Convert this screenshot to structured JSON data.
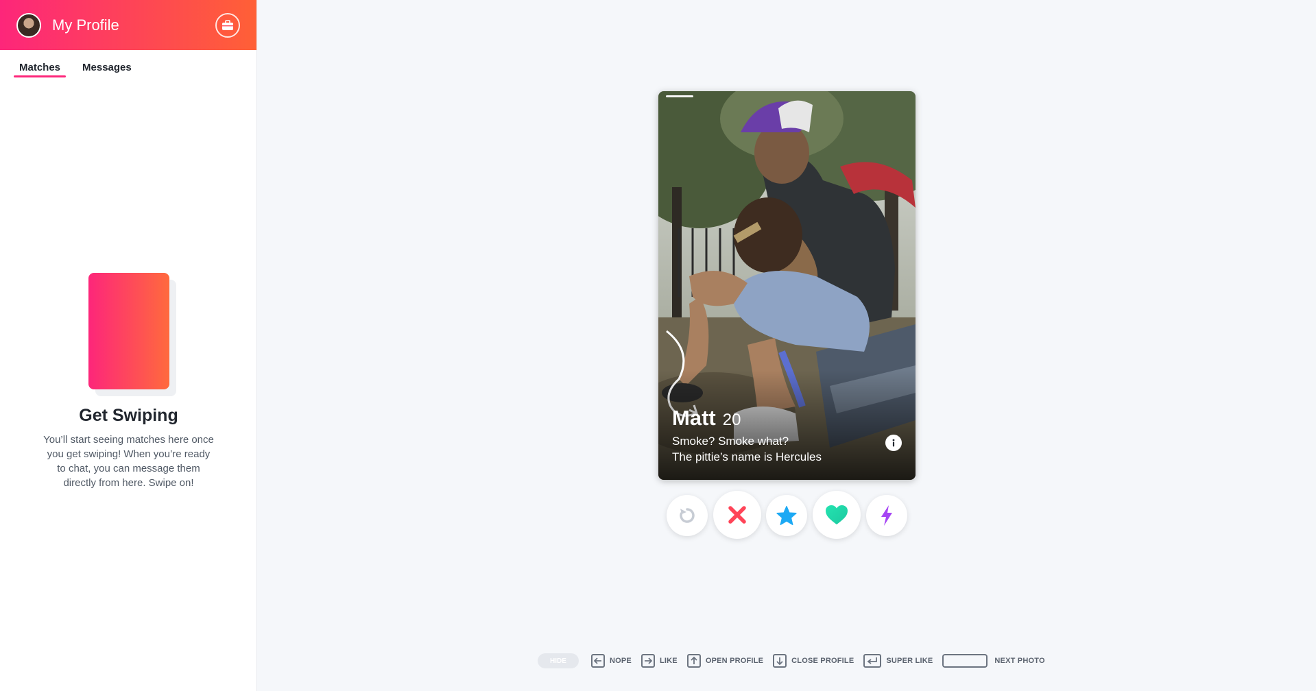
{
  "sidebar": {
    "profile_title": "My Profile",
    "tabs": [
      {
        "label": "Matches",
        "active": true
      },
      {
        "label": "Messages",
        "active": false
      }
    ],
    "empty_state": {
      "title": "Get Swiping",
      "text": "You’ll start seeing matches here once you get swiping! When you’re ready to chat, you can message them directly from here. Swipe on!"
    }
  },
  "card": {
    "name": "Matt",
    "age": "20",
    "bio_line1": "Smoke? Smoke what?",
    "bio_line2": "The pittie’s name is Hercules"
  },
  "actions": [
    {
      "name": "rewind",
      "icon": "rewind-icon",
      "color": "#c7ccd4"
    },
    {
      "name": "nope",
      "icon": "x-icon",
      "color": "#ff4458"
    },
    {
      "name": "super-like",
      "icon": "star-icon",
      "color": "#1ca9f4"
    },
    {
      "name": "like",
      "icon": "heart-icon",
      "color": "#1ee3a0"
    },
    {
      "name": "boost",
      "icon": "lightning-icon",
      "color": "#a645f4"
    }
  ],
  "hints": {
    "hide": "HIDE",
    "nope": "NOPE",
    "like": "LIKE",
    "open_profile": "OPEN PROFILE",
    "close_profile": "CLOSE PROFILE",
    "super_like": "SUPER LIKE",
    "next_photo": "NEXT PHOTO"
  },
  "colors": {
    "brand_start": "#fd267a",
    "brand_end": "#ff6036"
  }
}
